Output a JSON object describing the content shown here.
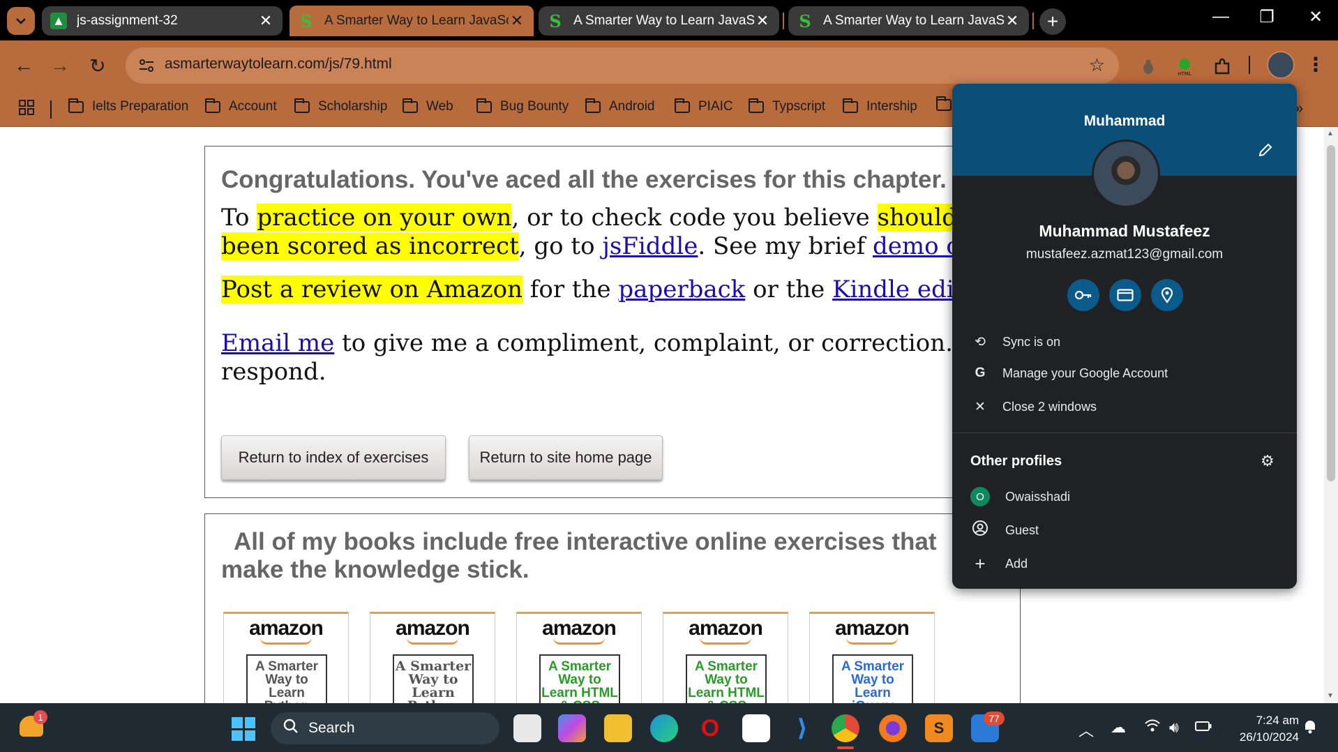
{
  "tabs": [
    {
      "title": "js-assignment-32",
      "close": "✕"
    },
    {
      "title": "A Smarter Way to Learn JavaScr",
      "close": "✕"
    },
    {
      "title": "A Smarter Way to Learn JavaScr",
      "close": "✕"
    },
    {
      "title": "A Smarter Way to Learn JavaScr",
      "close": "✕"
    }
  ],
  "toolbar": {
    "url": "asmarterwaytolearn.com/js/79.html"
  },
  "bookmarks": [
    "Ielts Preparation",
    "Account",
    "Scholarship",
    "Web",
    "Bug Bounty",
    "Android",
    "PIAIC",
    "Typscript",
    "Intership"
  ],
  "content": {
    "congrats_heading": "Congratulations. You've aced all the exercises for this chapter.",
    "p1_a": "To ",
    "p1_hl1": "practice on your own",
    "p1_b": ", or to check code you believe ",
    "p1_hl2": "shouldn't have",
    "p1_hl3": "been scored as incorrect",
    "p1_c": ", go to ",
    "p1_link1": "jsFiddle",
    "p1_d": ". See my brief ",
    "p1_link2": "demo of jsFiddle",
    "p2_hl": "Post a review on Amazon",
    "p2_a": " for the ",
    "p2_link1": "paperback",
    "p2_b": " or the ",
    "p2_link2": "Kindle edition",
    "p2_c": ".",
    "p3_link": "Email me",
    "p3_a": " to give me a compliment, complaint, or correction. I'll",
    "p3_b": "respond.",
    "btn_exercises": "Return to index of exercises",
    "btn_home": "Return to site home page",
    "books_heading_1": "All of my books include free interactive online exercises that",
    "books_heading_2": "make the knowledge stick.",
    "books": [
      {
        "brand": "amazon",
        "cover": "A Smarter Way to Learn Python",
        "color": "#555555"
      },
      {
        "brand": "amazon",
        "cover": "A Smarter Way to Learn Python",
        "color": "#555555"
      },
      {
        "brand": "amazon",
        "cover": "A Smarter Way to Learn HTML & CSS",
        "color": "#2a9a2a"
      },
      {
        "brand": "amazon",
        "cover": "A Smarter Way to Learn HTML & CSS",
        "color": "#2a9a2a"
      },
      {
        "brand": "amazon",
        "cover": "A Smarter Way to Learn jQuery",
        "color": "#2a6ad8"
      }
    ]
  },
  "profile": {
    "header_name": "Muhammad",
    "full_name": "Muhammad Mustafeez",
    "email": "mustafeez.azmat123@gmail.com",
    "sync": "Sync is on",
    "manage": "Manage your Google Account",
    "close_windows": "Close 2 windows",
    "other_profiles": "Other profiles",
    "profiles": [
      {
        "initial": "O",
        "name": "Owaisshadi"
      },
      {
        "name": "Guest"
      }
    ],
    "add": "Add"
  },
  "taskbar": {
    "search": "Search",
    "notification_badge": "1",
    "app_badge": "77",
    "time": "7:24 am",
    "date": "26/10/2024"
  },
  "colors": {
    "chrome_accent": "#b86b3c",
    "popup_header": "#0b4f79",
    "highlight": "#ffff00",
    "link": "#1a0dab"
  }
}
